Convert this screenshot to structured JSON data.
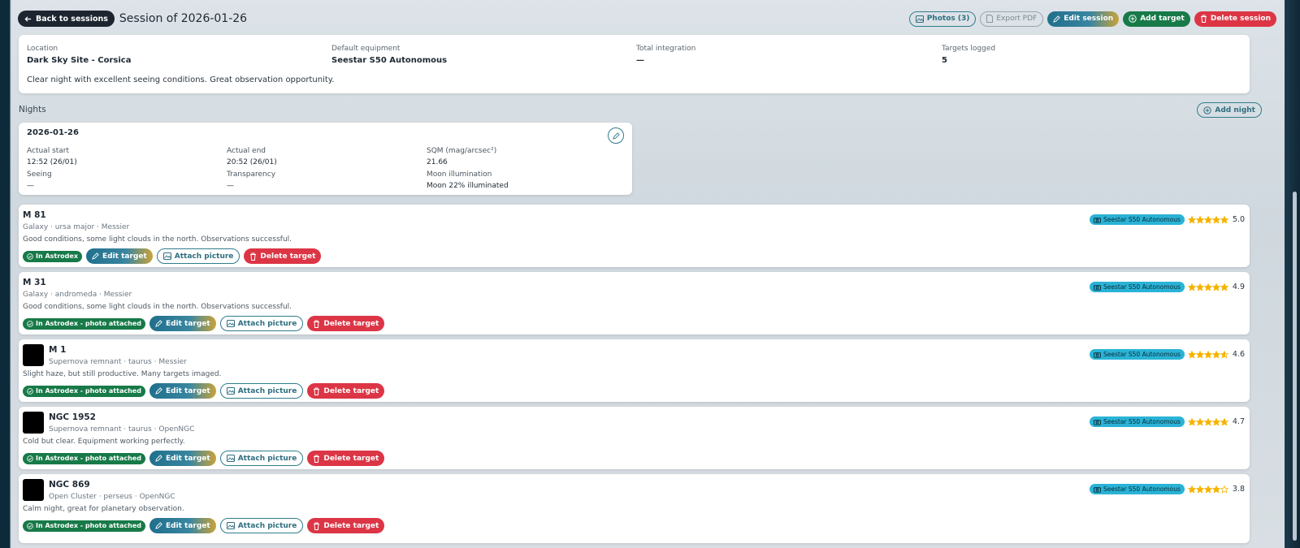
{
  "header": {
    "back_label": "Back to sessions",
    "title": "Session of 2026-01-26",
    "actions": {
      "photos": "Photos (3)",
      "export_pdf": "Export PDF",
      "edit_session": "Edit session",
      "add_target": "Add target",
      "delete_session": "Delete session"
    }
  },
  "summary": {
    "location_label": "Location",
    "location": "Dark Sky Site - Corsica",
    "equipment_label": "Default equipment",
    "equipment": "Seestar S50 Autonomous",
    "integration_label": "Total integration",
    "integration": "—",
    "targets_label": "Targets logged",
    "targets": "5",
    "note": "Clear night with excellent seeing conditions. Great observation opportunity."
  },
  "nights": {
    "heading": "Nights",
    "add_label": "Add night",
    "items": [
      {
        "date": "2026-01-26",
        "actual_start_label": "Actual start",
        "actual_start": "12:52 (26/01)",
        "actual_end_label": "Actual end",
        "actual_end": "20:52 (26/01)",
        "sqm_label": "SQM (mag/arcsec²)",
        "sqm": "21.66",
        "seeing_label": "Seeing",
        "seeing": "—",
        "transparency_label": "Transparency",
        "transparency": "—",
        "moon_label": "Moon illumination",
        "moon": "Moon 22% illuminated"
      }
    ]
  },
  "target_buttons": {
    "edit": "Edit target",
    "attach": "Attach picture",
    "delete": "Delete target"
  },
  "targets": [
    {
      "name": "M 81",
      "meta": "Galaxy · ursa major · Messier",
      "note": "Good conditions, some light clouds in the north. Observations successful.",
      "status": "In Astrodex",
      "equipment": "Seestar S50 Autonomous",
      "rating": 5.0,
      "rating_text": "5.0",
      "has_thumb": false
    },
    {
      "name": "M 31",
      "meta": "Galaxy · andromeda · Messier",
      "note": "Good conditions, some light clouds in the north. Observations successful.",
      "status": "In Astrodex - photo attached",
      "equipment": "Seestar S50 Autonomous",
      "rating": 4.9,
      "rating_text": "4.9",
      "has_thumb": false
    },
    {
      "name": "M 1",
      "meta": "Supernova remnant · taurus · Messier",
      "note": "Slight haze, but still productive. Many targets imaged.",
      "status": "In Astrodex - photo attached",
      "equipment": "Seestar S50 Autonomous",
      "rating": 4.6,
      "rating_text": "4.6",
      "has_thumb": true
    },
    {
      "name": "NGC 1952",
      "meta": "Supernova remnant · taurus · OpenNGC",
      "note": "Cold but clear. Equipment working perfectly.",
      "status": "In Astrodex - photo attached",
      "equipment": "Seestar S50 Autonomous",
      "rating": 4.7,
      "rating_text": "4.7",
      "has_thumb": true
    },
    {
      "name": "NGC 869",
      "meta": "Open Cluster · perseus · OpenNGC",
      "note": "Calm night, great for planetary observation.",
      "status": "In Astrodex - photo attached",
      "equipment": "Seestar S50 Autonomous",
      "rating": 3.8,
      "rating_text": "3.8",
      "has_thumb": true
    }
  ],
  "colors": {
    "edit_gradient": "#1f6f8c",
    "green": "#177a48",
    "red": "#dc3545",
    "equipment_badge": "#2ab3d6",
    "star": "#f5b301"
  }
}
